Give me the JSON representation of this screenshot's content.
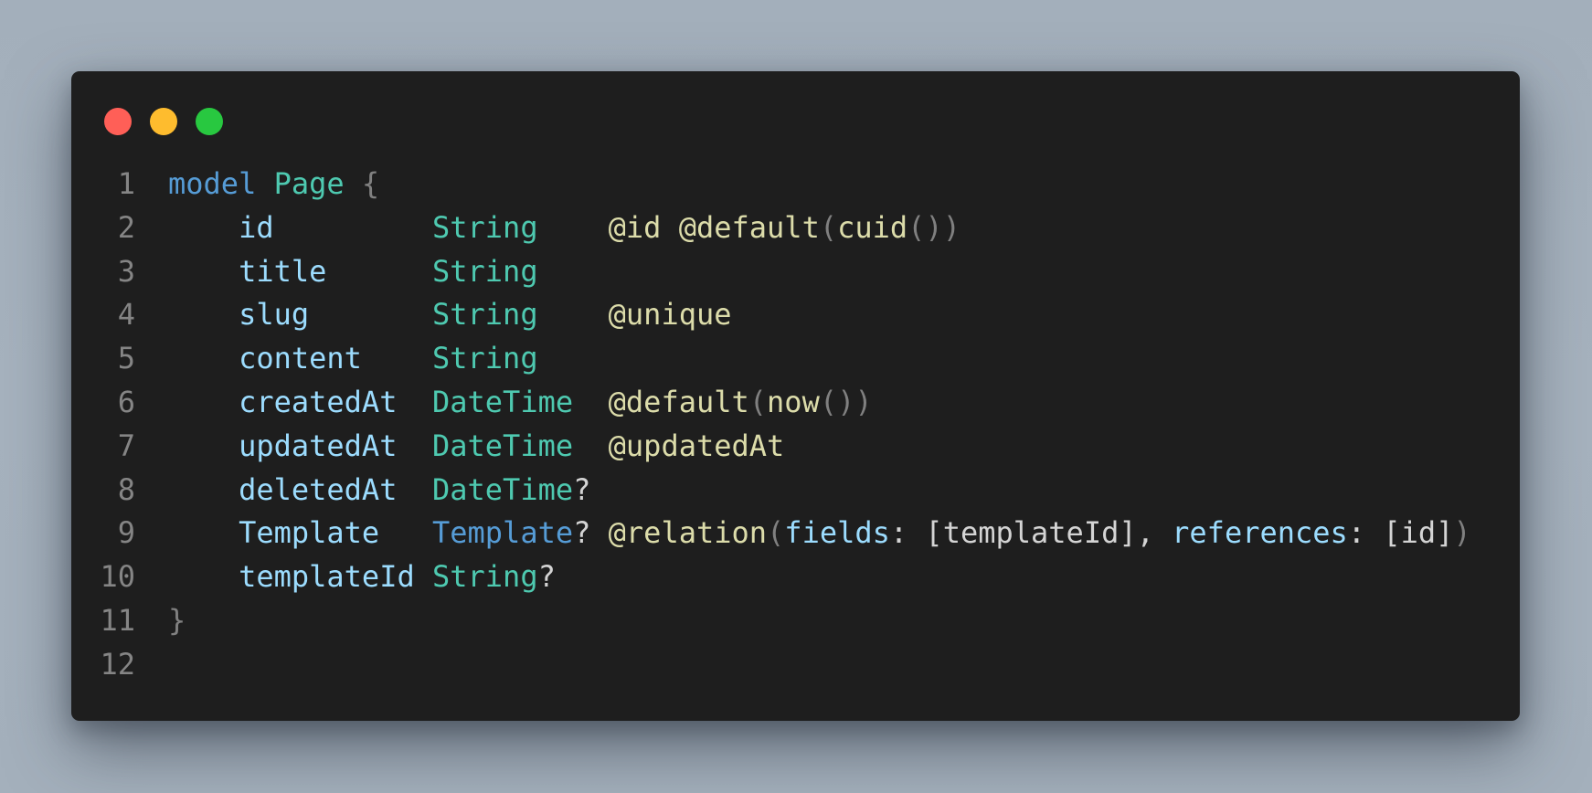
{
  "window": {
    "traffic_lights": [
      {
        "name": "close",
        "color": "#ff5f57"
      },
      {
        "name": "minimize",
        "color": "#febc2e"
      },
      {
        "name": "maximize",
        "color": "#28c840"
      }
    ]
  },
  "editor": {
    "language": "prisma",
    "lines": [
      {
        "n": "1",
        "tokens": [
          {
            "t": "model",
            "c": "kw"
          },
          {
            "t": " ",
            "c": "plain"
          },
          {
            "t": "Page",
            "c": "type"
          },
          {
            "t": " ",
            "c": "plain"
          },
          {
            "t": "{",
            "c": "punct"
          }
        ]
      },
      {
        "n": "2",
        "tokens": [
          {
            "t": "    ",
            "c": "plain"
          },
          {
            "t": "id",
            "c": "field"
          },
          {
            "t": "         ",
            "c": "plain"
          },
          {
            "t": "String",
            "c": "type"
          },
          {
            "t": "    ",
            "c": "plain"
          },
          {
            "t": "@id @default",
            "c": "attr"
          },
          {
            "t": "(",
            "c": "punct"
          },
          {
            "t": "cuid",
            "c": "attr"
          },
          {
            "t": "())",
            "c": "punct"
          }
        ]
      },
      {
        "n": "3",
        "tokens": [
          {
            "t": "    ",
            "c": "plain"
          },
          {
            "t": "title",
            "c": "field"
          },
          {
            "t": "      ",
            "c": "plain"
          },
          {
            "t": "String",
            "c": "type"
          }
        ]
      },
      {
        "n": "4",
        "tokens": [
          {
            "t": "    ",
            "c": "plain"
          },
          {
            "t": "slug",
            "c": "field"
          },
          {
            "t": "       ",
            "c": "plain"
          },
          {
            "t": "String",
            "c": "type"
          },
          {
            "t": "    ",
            "c": "plain"
          },
          {
            "t": "@unique",
            "c": "attr"
          }
        ]
      },
      {
        "n": "5",
        "tokens": [
          {
            "t": "    ",
            "c": "plain"
          },
          {
            "t": "content",
            "c": "field"
          },
          {
            "t": "    ",
            "c": "plain"
          },
          {
            "t": "String",
            "c": "type"
          }
        ]
      },
      {
        "n": "6",
        "tokens": [
          {
            "t": "    ",
            "c": "plain"
          },
          {
            "t": "createdAt",
            "c": "field"
          },
          {
            "t": "  ",
            "c": "plain"
          },
          {
            "t": "DateTime",
            "c": "type"
          },
          {
            "t": "  ",
            "c": "plain"
          },
          {
            "t": "@default",
            "c": "attr"
          },
          {
            "t": "(",
            "c": "punct"
          },
          {
            "t": "now",
            "c": "attr"
          },
          {
            "t": "())",
            "c": "punct"
          }
        ]
      },
      {
        "n": "7",
        "tokens": [
          {
            "t": "    ",
            "c": "plain"
          },
          {
            "t": "updatedAt",
            "c": "field"
          },
          {
            "t": "  ",
            "c": "plain"
          },
          {
            "t": "DateTime",
            "c": "type"
          },
          {
            "t": "  ",
            "c": "plain"
          },
          {
            "t": "@updatedAt",
            "c": "attr"
          }
        ]
      },
      {
        "n": "8",
        "tokens": [
          {
            "t": "    ",
            "c": "plain"
          },
          {
            "t": "deletedAt",
            "c": "field"
          },
          {
            "t": "  ",
            "c": "plain"
          },
          {
            "t": "DateTime",
            "c": "type"
          },
          {
            "t": "?",
            "c": "plain"
          }
        ]
      },
      {
        "n": "9",
        "tokens": [
          {
            "t": "    ",
            "c": "plain"
          },
          {
            "t": "Template",
            "c": "field"
          },
          {
            "t": "   ",
            "c": "plain"
          },
          {
            "t": "Template",
            "c": "reltype"
          },
          {
            "t": "? ",
            "c": "plain"
          },
          {
            "t": "@relation",
            "c": "attr"
          },
          {
            "t": "(",
            "c": "punct"
          },
          {
            "t": "fields",
            "c": "field"
          },
          {
            "t": ": [templateId], ",
            "c": "plain"
          },
          {
            "t": "references",
            "c": "field"
          },
          {
            "t": ": [id]",
            "c": "plain"
          },
          {
            "t": ")",
            "c": "punct"
          }
        ]
      },
      {
        "n": "10",
        "tokens": [
          {
            "t": "    ",
            "c": "plain"
          },
          {
            "t": "templateId",
            "c": "field"
          },
          {
            "t": " ",
            "c": "plain"
          },
          {
            "t": "String",
            "c": "type"
          },
          {
            "t": "?",
            "c": "plain"
          }
        ]
      },
      {
        "n": "11",
        "tokens": [
          {
            "t": "}",
            "c": "punct"
          }
        ]
      },
      {
        "n": "12",
        "tokens": []
      }
    ]
  }
}
